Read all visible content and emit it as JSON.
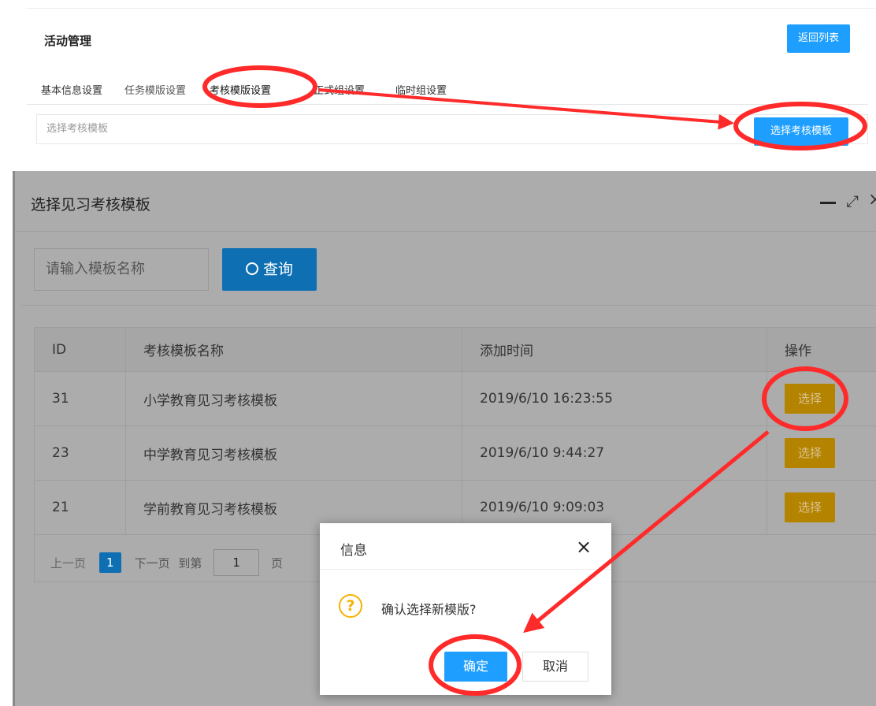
{
  "top": {
    "title": "活动管理",
    "back_label": "返回列表",
    "tabs": [
      "基本信息设置",
      "任务模版设置",
      "考核模版设置",
      "正式组设置",
      "临时组设置"
    ],
    "input_placeholder": "选择考核模板",
    "pick_label": "选择考核模板"
  },
  "dialog": {
    "title": "选择见习考核模板",
    "search_placeholder": "请输入模板名称",
    "search_label": "查询",
    "columns": [
      "ID",
      "考核模板名称",
      "添加时间",
      "操作"
    ],
    "rows": [
      {
        "id": "31",
        "name": "小学教育见习考核模板",
        "time": "2019/6/10 16:23:55",
        "action": "选择"
      },
      {
        "id": "23",
        "name": "中学教育见习考核模板",
        "time": "2019/6/10 9:44:27",
        "action": "选择"
      },
      {
        "id": "21",
        "name": "学前教育见习考核模板",
        "time": "2019/6/10 9:09:03",
        "action": "选择"
      }
    ],
    "pager": {
      "prev": "上一页",
      "current": "1",
      "next": "下一页",
      "goto": "到第",
      "page_value": "1",
      "unit": "页"
    }
  },
  "confirm": {
    "title": "信息",
    "message": "确认选择新模版?",
    "ok_label": "确定",
    "cancel_label": "取消"
  },
  "colors": {
    "primary": "#1e9fff",
    "annotation": "#ff2a2a",
    "select_button": "#b48400",
    "warning_icon": "#f5b200"
  },
  "icons": {
    "search": "search-icon",
    "minimize": "minimize-icon",
    "maximize": "maximize-icon",
    "close": "close-icon",
    "question": "question-icon"
  }
}
